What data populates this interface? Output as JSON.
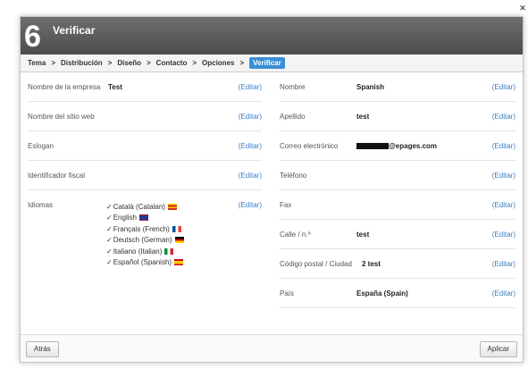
{
  "header": {
    "step": "6",
    "title": "Verificar",
    "close_icon": "close-icon"
  },
  "breadcrumb": [
    "Tema",
    "Distribución",
    "Diseño",
    "Contacto",
    "Opciones",
    "Verificar"
  ],
  "left": {
    "company": {
      "label": "Nombre de la empresa",
      "value": "Test",
      "edit": "(Editar)"
    },
    "site": {
      "label": "Nombre del sitio web",
      "value": "",
      "edit": "(Editar)"
    },
    "slogan": {
      "label": "Eslogan",
      "value": "",
      "edit": "(Editar)"
    },
    "taxid": {
      "label": "Identificador fiscal",
      "value": "",
      "edit": "(Editar)"
    },
    "languages": {
      "label": "Idiomas",
      "edit": "(Editar)",
      "items": [
        {
          "name": "Català (Catalan)",
          "flag": "catalan-flag",
          "colors": [
            "#f7c600",
            "#d52b1e"
          ]
        },
        {
          "name": "English",
          "flag": "uk-flag",
          "colors": [
            "#1f3a93",
            "#c8102e"
          ]
        },
        {
          "name": "Français (French)",
          "flag": "france-flag",
          "colors": [
            "#0055a4",
            "#ef4135"
          ]
        },
        {
          "name": "Deutsch (German)",
          "flag": "germany-flag",
          "colors": [
            "#000000",
            "#dd0000",
            "#ffce00"
          ]
        },
        {
          "name": "Italiano (Italian)",
          "flag": "italy-flag",
          "colors": [
            "#009246",
            "#ce2b37"
          ]
        },
        {
          "name": "Español (Spanish)",
          "flag": "spain-flag",
          "colors": [
            "#c60b1e",
            "#ffc400"
          ]
        }
      ]
    }
  },
  "right": {
    "firstname": {
      "label": "Nombre",
      "value": "Spanish",
      "edit": "(Editar)"
    },
    "lastname": {
      "label": "Apellido",
      "value": "test",
      "edit": "(Editar)"
    },
    "email": {
      "label": "Correo electrónico",
      "value": "@epages.com",
      "edit": "(Editar)"
    },
    "phone": {
      "label": "Teléfono",
      "value": "",
      "edit": "(Editar)"
    },
    "fax": {
      "label": "Fax",
      "value": "",
      "edit": "(Editar)"
    },
    "street": {
      "label": "Calle / n.º",
      "value": "test",
      "edit": "(Editar)"
    },
    "zip": {
      "label": "Código postal / Ciudad",
      "value": "2 test",
      "edit": "(Editar)"
    },
    "country": {
      "label": "País",
      "value": "España (Spain)",
      "edit": "(Editar)"
    }
  },
  "footer": {
    "back": "Atrás",
    "apply": "Aplicar"
  },
  "colors": {
    "accent": "#3b8fd6",
    "link": "#3a7fc4",
    "titlebar": "#5a5a5a"
  }
}
